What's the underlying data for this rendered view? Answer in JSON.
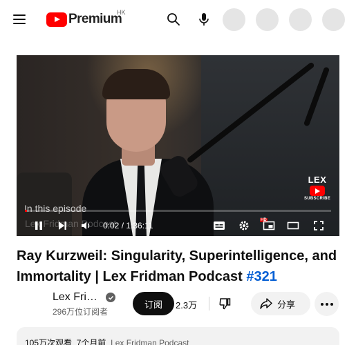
{
  "header": {
    "logo_text": "Premium",
    "region": "HK",
    "icons": [
      "menu-icon",
      "search-icon",
      "mic-icon"
    ]
  },
  "player": {
    "chapter_title": "In this episode",
    "overlay_text": "Lex Fridman Podcast",
    "current_time": "0:02",
    "total_time": "1:36:11",
    "time_display": "0:02 / 1:36:11",
    "progress_fraction": 0.001,
    "watermark": {
      "name": "LEX",
      "subscribe": "SUBSCRIBE"
    },
    "hd_badge": "HD"
  },
  "video": {
    "title_main": "Ray Kurzweil: Singularity, Superintelligence, and Immortality | Lex Fridman Podcast ",
    "title_hashtag": "#321"
  },
  "channel": {
    "name": "Lex Fridman",
    "name_display": "Lex Fri…",
    "subscribers": "296万位订阅者",
    "subscribe_label": "订阅"
  },
  "actions": {
    "like_count": "2.3万",
    "share_label": "分享"
  },
  "description": {
    "views": "105万次观看",
    "date": "7个月前",
    "tag": "Lex Fridman Podcast"
  },
  "colors": {
    "brand_red": "#ff0000",
    "hashtag_blue": "#065fd4",
    "subscribe_bg": "#0f0f0f",
    "chip_bg": "#f2f2f2"
  }
}
